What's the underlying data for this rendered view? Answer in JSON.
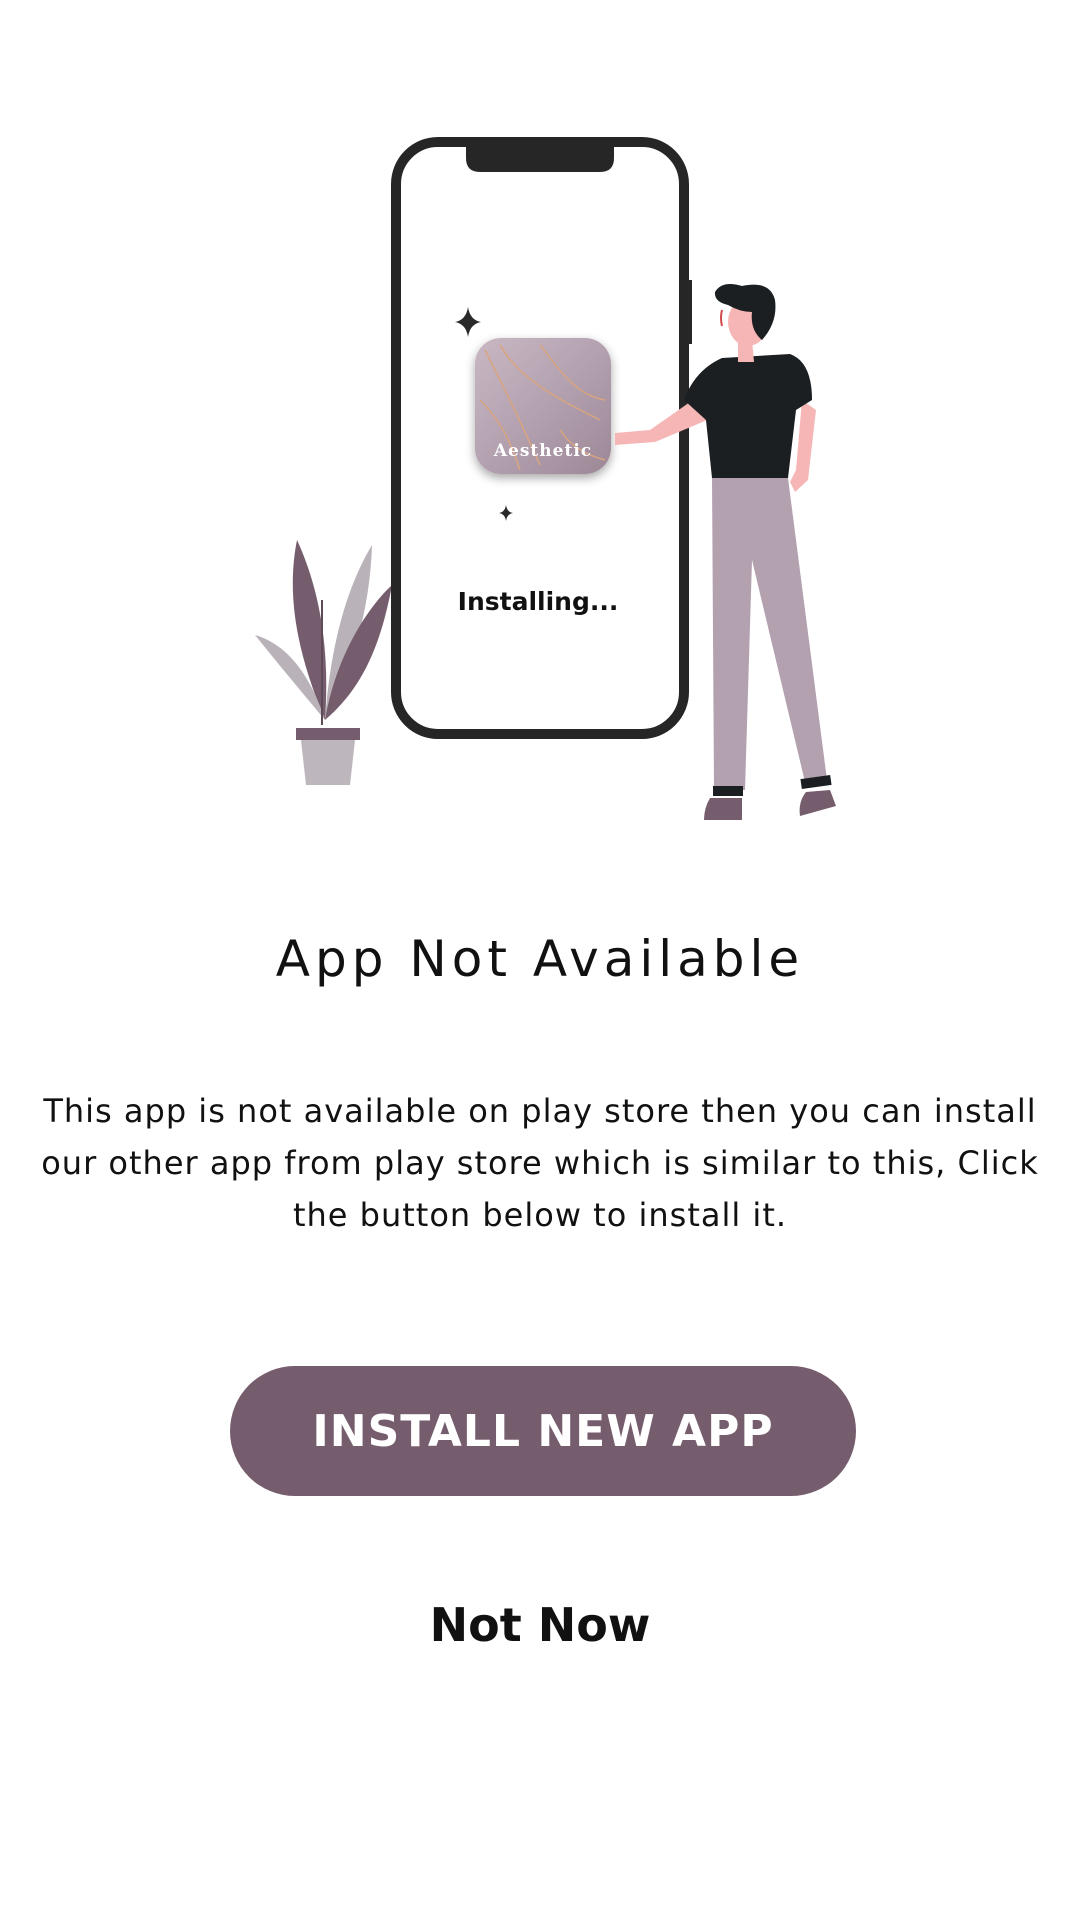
{
  "illustration": {
    "app_icon_label": "Aesthetic",
    "phone_status_text": "Installing...",
    "icons": {
      "phone": "phone-icon",
      "person": "person-icon",
      "plant": "plant-icon",
      "sparkle": "sparkle-icon",
      "app": "app-icon"
    }
  },
  "dialog": {
    "title": "App Not Available",
    "message": "This app is not available on play store then you can install our other app from play store which is similar to this, Click the button below to install it.",
    "install_label": "INSTALL NEW APP",
    "dismiss_label": "Not Now"
  },
  "colors": {
    "accent": "#765d6e",
    "text": "#111111",
    "background": "#ffffff"
  }
}
